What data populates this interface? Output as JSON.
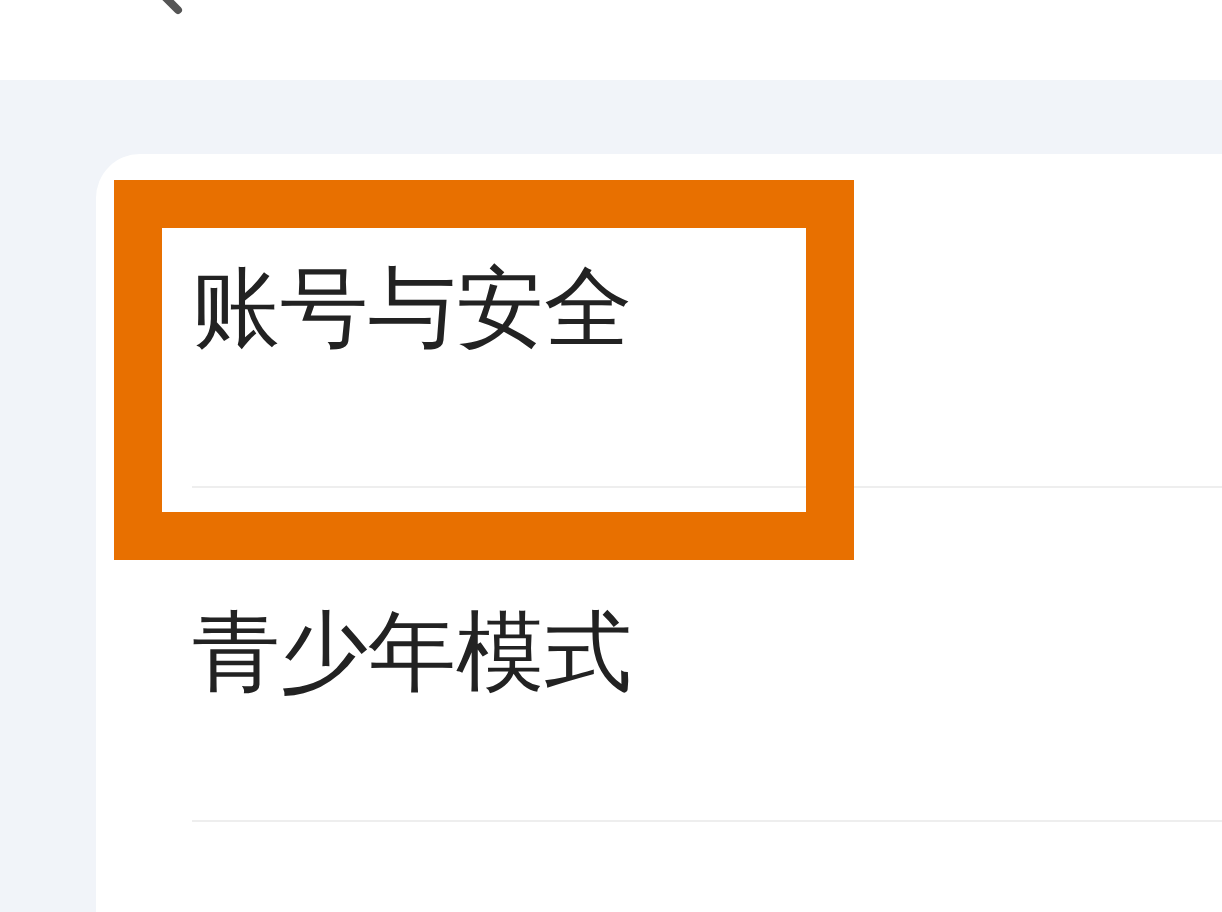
{
  "settings_list": [
    {
      "label": "账号与安全",
      "highlighted": true
    },
    {
      "label": "青少年模式",
      "highlighted": false
    }
  ]
}
